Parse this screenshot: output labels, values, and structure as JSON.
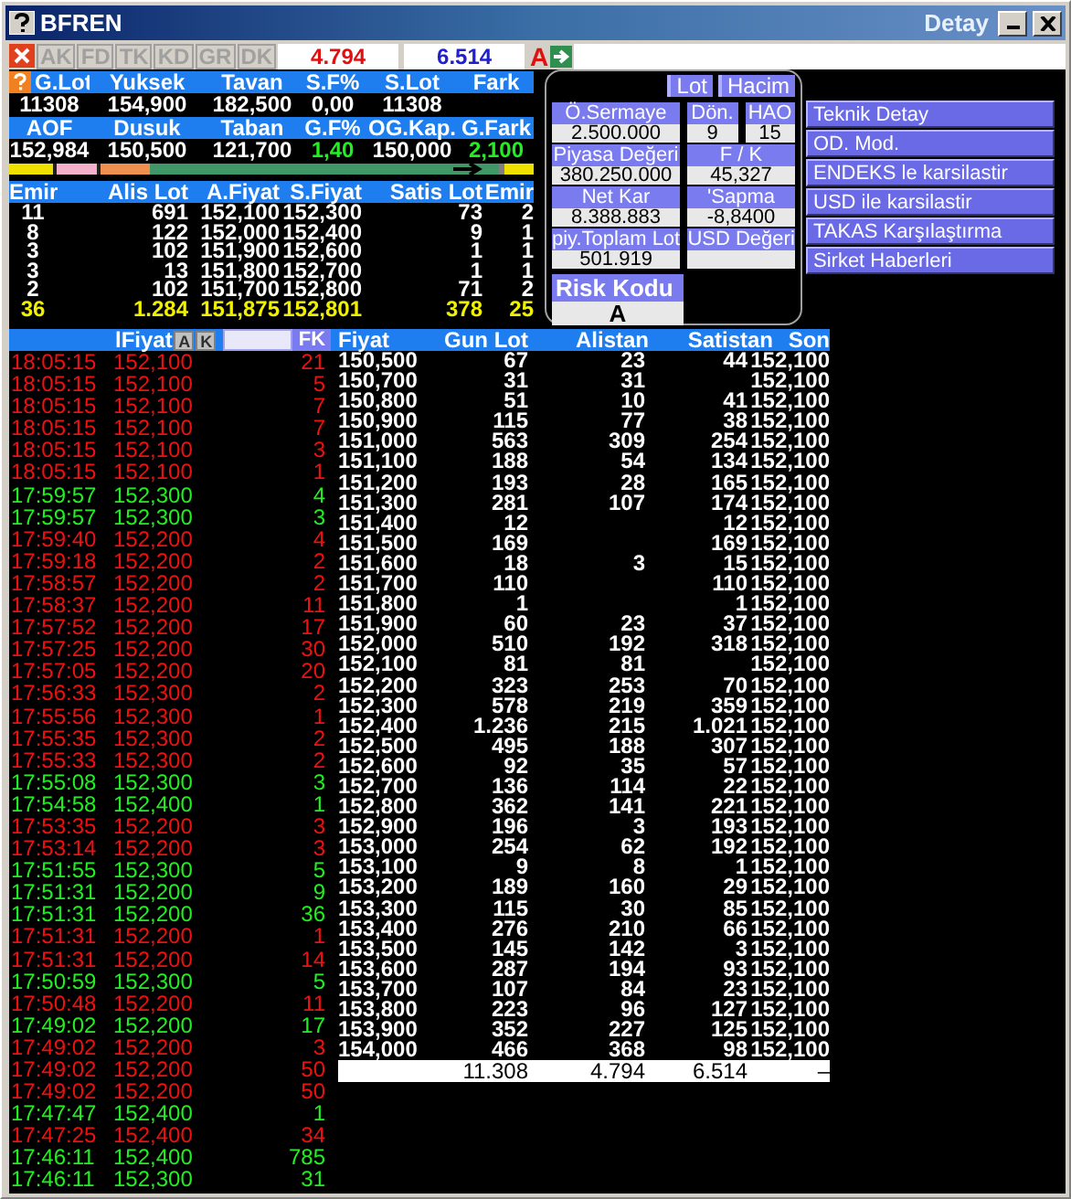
{
  "window": {
    "title": "BFREN",
    "detail_label": "Detay"
  },
  "toolbar": {
    "tabs": [
      "AK",
      "FD",
      "TK",
      "KD",
      "GR",
      "DK"
    ],
    "buy_total": "4.794",
    "sell_total": "6.514",
    "flag": "A"
  },
  "summary": [
    {
      "label": "G.Lot",
      "value": "11308",
      "uptick": false
    },
    {
      "label": "Yuksek",
      "value": "154,900",
      "uptick": false
    },
    {
      "label": "Tavan",
      "value": "182,500",
      "uptick": false
    },
    {
      "label": "S.F%",
      "value": "0,00",
      "uptick": false
    },
    {
      "label": "S.Lot",
      "value": "11308",
      "uptick": false
    },
    {
      "label": "Fark"
    },
    {
      "label": "AOF",
      "value": "152,984",
      "uptick": false
    },
    {
      "label": "Dusuk",
      "value": "150,500",
      "uptick": false
    },
    {
      "label": "Taban",
      "value": "121,700",
      "uptick": false
    },
    {
      "label": "G.F%",
      "value": "1,40",
      "uptick": true
    },
    {
      "label": "OG.Kap.",
      "value": "150,000",
      "uptick": false
    },
    {
      "label": "G.Fark",
      "value": "2,100",
      "uptick": true
    }
  ],
  "order_book": {
    "columns": [
      "Emir",
      "Alis Lot",
      "A.Fiyat",
      "S.Fiyat",
      "Satis Lot",
      "Emir"
    ],
    "rows": [
      [
        "11",
        "691",
        "152,100",
        "152,300",
        "73",
        "2"
      ],
      [
        "8",
        "122",
        "152,000",
        "152,400",
        "9",
        "1"
      ],
      [
        "3",
        "102",
        "151,900",
        "152,600",
        "1",
        "1"
      ],
      [
        "3",
        "13",
        "151,800",
        "152,700",
        "1",
        "1"
      ],
      [
        "2",
        "102",
        "151,700",
        "152,800",
        "71",
        "2"
      ]
    ],
    "total": [
      "36",
      "1.284",
      "151,875",
      "152,801",
      "378",
      "25"
    ]
  },
  "detail_panel": {
    "toggles": [
      "Lot",
      "Hacim"
    ],
    "rows": [
      [
        {
          "label": "Ö.Sermaye",
          "value": "2.500.000"
        },
        {
          "label": "Dön.",
          "value": "9"
        },
        {
          "label": "HAO",
          "value": "15"
        }
      ],
      [
        {
          "label": "Piyasa Değeri",
          "value": "380.250.000"
        },
        {
          "label": "F / K",
          "value": "45,327"
        }
      ],
      [
        {
          "label": "Net Kar",
          "value": "8.388.883"
        },
        {
          "label": "'Sapma",
          "value": "-8,8400"
        }
      ],
      [
        {
          "label": "piy.Toplam Lot",
          "value": "501.919"
        },
        {
          "label": "USD Değeri"
        }
      ]
    ],
    "risk": {
      "label": "Risk Kodu",
      "value": "A"
    }
  },
  "side_buttons": [
    "Teknik Detay",
    "OD. Mod.",
    "ENDEKS le karsilastir",
    "USD ile karsilastir",
    "TAKAS Karşılaştırma",
    "Sirket Haberleri"
  ],
  "trades": {
    "column": "lFiyat",
    "buttons": [
      "A",
      "K"
    ],
    "filter_button": "FK",
    "rows": [
      {
        "time": "18:05:15",
        "price": "152,100",
        "lot": "21",
        "uptick": false
      },
      {
        "time": "18:05:15",
        "price": "152,100",
        "lot": "5",
        "uptick": false
      },
      {
        "time": "18:05:15",
        "price": "152,100",
        "lot": "7",
        "uptick": false
      },
      {
        "time": "18:05:15",
        "price": "152,100",
        "lot": "7",
        "uptick": false
      },
      {
        "time": "18:05:15",
        "price": "152,100",
        "lot": "3",
        "uptick": false
      },
      {
        "time": "18:05:15",
        "price": "152,100",
        "lot": "1",
        "uptick": false
      },
      {
        "time": "17:59:57",
        "price": "152,300",
        "lot": "4",
        "uptick": true
      },
      {
        "time": "17:59:57",
        "price": "152,300",
        "lot": "3",
        "uptick": true
      },
      {
        "time": "17:59:40",
        "price": "152,200",
        "lot": "4",
        "uptick": false
      },
      {
        "time": "17:59:18",
        "price": "152,200",
        "lot": "2",
        "uptick": false
      },
      {
        "time": "17:58:57",
        "price": "152,200",
        "lot": "2",
        "uptick": false
      },
      {
        "time": "17:58:37",
        "price": "152,200",
        "lot": "11",
        "uptick": false
      },
      {
        "time": "17:57:52",
        "price": "152,200",
        "lot": "17",
        "uptick": false
      },
      {
        "time": "17:57:25",
        "price": "152,200",
        "lot": "30",
        "uptick": false
      },
      {
        "time": "17:57:05",
        "price": "152,200",
        "lot": "20",
        "uptick": false
      },
      {
        "time": "17:56:33",
        "price": "152,300",
        "lot": "2",
        "uptick": false
      },
      {
        "time": "17:55:56",
        "price": "152,300",
        "lot": "1",
        "uptick": false
      },
      {
        "time": "17:55:35",
        "price": "152,300",
        "lot": "2",
        "uptick": false
      },
      {
        "time": "17:55:33",
        "price": "152,300",
        "lot": "2",
        "uptick": false
      },
      {
        "time": "17:55:08",
        "price": "152,300",
        "lot": "3",
        "uptick": true
      },
      {
        "time": "17:54:58",
        "price": "152,400",
        "lot": "1",
        "uptick": true
      },
      {
        "time": "17:53:35",
        "price": "152,200",
        "lot": "3",
        "uptick": false
      },
      {
        "time": "17:53:14",
        "price": "152,200",
        "lot": "3",
        "uptick": false
      },
      {
        "time": "17:51:55",
        "price": "152,300",
        "lot": "5",
        "uptick": true
      },
      {
        "time": "17:51:31",
        "price": "152,200",
        "lot": "9",
        "uptick": true
      },
      {
        "time": "17:51:31",
        "price": "152,200",
        "lot": "36",
        "uptick": true
      },
      {
        "time": "17:51:31",
        "price": "152,200",
        "lot": "1",
        "uptick": false
      },
      {
        "time": "17:51:31",
        "price": "152,200",
        "lot": "14",
        "uptick": false
      },
      {
        "time": "17:50:59",
        "price": "152,300",
        "lot": "5",
        "uptick": true
      },
      {
        "time": "17:50:48",
        "price": "152,200",
        "lot": "11",
        "uptick": false
      },
      {
        "time": "17:49:02",
        "price": "152,200",
        "lot": "17",
        "uptick": true
      },
      {
        "time": "17:49:02",
        "price": "152,200",
        "lot": "3",
        "uptick": false
      },
      {
        "time": "17:49:02",
        "price": "152,200",
        "lot": "50",
        "uptick": false
      },
      {
        "time": "17:49:02",
        "price": "152,200",
        "lot": "50",
        "uptick": false
      },
      {
        "time": "17:47:47",
        "price": "152,400",
        "lot": "1",
        "uptick": true
      },
      {
        "time": "17:47:25",
        "price": "152,400",
        "lot": "34",
        "uptick": false
      },
      {
        "time": "17:46:11",
        "price": "152,400",
        "lot": "785",
        "uptick": true
      },
      {
        "time": "17:46:11",
        "price": "152,300",
        "lot": "31",
        "uptick": true
      }
    ]
  },
  "depth": {
    "columns": [
      "Fiyat",
      "Gun Lot",
      "Alistan",
      "Satistan",
      "Son"
    ],
    "rows": [
      {
        "price": "150,500",
        "gun_lot": "67",
        "alistan": "23",
        "satistan": "44",
        "son": "152,100"
      },
      {
        "price": "150,700",
        "gun_lot": "31",
        "alistan": "31",
        "son": "152,100"
      },
      {
        "price": "150,800",
        "gun_lot": "51",
        "alistan": "10",
        "satistan": "41",
        "son": "152,100"
      },
      {
        "price": "150,900",
        "gun_lot": "115",
        "alistan": "77",
        "satistan": "38",
        "son": "152,100"
      },
      {
        "price": "151,000",
        "gun_lot": "563",
        "alistan": "309",
        "satistan": "254",
        "son": "152,100"
      },
      {
        "price": "151,100",
        "gun_lot": "188",
        "alistan": "54",
        "satistan": "134",
        "son": "152,100"
      },
      {
        "price": "151,200",
        "gun_lot": "193",
        "alistan": "28",
        "satistan": "165",
        "son": "152,100"
      },
      {
        "price": "151,300",
        "gun_lot": "281",
        "alistan": "107",
        "satistan": "174",
        "son": "152,100"
      },
      {
        "price": "151,400",
        "gun_lot": "12",
        "satistan": "12",
        "son": "152,100"
      },
      {
        "price": "151,500",
        "gun_lot": "169",
        "satistan": "169",
        "son": "152,100"
      },
      {
        "price": "151,600",
        "gun_lot": "18",
        "alistan": "3",
        "satistan": "15",
        "son": "152,100"
      },
      {
        "price": "151,700",
        "gun_lot": "110",
        "satistan": "110",
        "son": "152,100"
      },
      {
        "price": "151,800",
        "gun_lot": "1",
        "satistan": "1",
        "son": "152,100"
      },
      {
        "price": "151,900",
        "gun_lot": "60",
        "alistan": "23",
        "satistan": "37",
        "son": "152,100"
      },
      {
        "price": "152,000",
        "gun_lot": "510",
        "alistan": "192",
        "satistan": "318",
        "son": "152,100"
      },
      {
        "price": "152,100",
        "gun_lot": "81",
        "alistan": "81",
        "son": "152,100"
      },
      {
        "price": "152,200",
        "gun_lot": "323",
        "alistan": "253",
        "satistan": "70",
        "son": "152,100"
      },
      {
        "price": "152,300",
        "gun_lot": "578",
        "alistan": "219",
        "satistan": "359",
        "son": "152,100"
      },
      {
        "price": "152,400",
        "gun_lot": "1.236",
        "alistan": "215",
        "satistan": "1.021",
        "son": "152,100"
      },
      {
        "price": "152,500",
        "gun_lot": "495",
        "alistan": "188",
        "satistan": "307",
        "son": "152,100"
      },
      {
        "price": "152,600",
        "gun_lot": "92",
        "alistan": "35",
        "satistan": "57",
        "son": "152,100"
      },
      {
        "price": "152,700",
        "gun_lot": "136",
        "alistan": "114",
        "satistan": "22",
        "son": "152,100"
      },
      {
        "price": "152,800",
        "gun_lot": "362",
        "alistan": "141",
        "satistan": "221",
        "son": "152,100"
      },
      {
        "price": "152,900",
        "gun_lot": "196",
        "alistan": "3",
        "satistan": "193",
        "son": "152,100"
      },
      {
        "price": "153,000",
        "gun_lot": "254",
        "alistan": "62",
        "satistan": "192",
        "son": "152,100"
      },
      {
        "price": "153,100",
        "gun_lot": "9",
        "alistan": "8",
        "satistan": "1",
        "son": "152,100"
      },
      {
        "price": "153,200",
        "gun_lot": "189",
        "alistan": "160",
        "satistan": "29",
        "son": "152,100"
      },
      {
        "price": "153,300",
        "gun_lot": "115",
        "alistan": "30",
        "satistan": "85",
        "son": "152,100"
      },
      {
        "price": "153,400",
        "gun_lot": "276",
        "alistan": "210",
        "satistan": "66",
        "son": "152,100"
      },
      {
        "price": "153,500",
        "gun_lot": "145",
        "alistan": "142",
        "satistan": "3",
        "son": "152,100"
      },
      {
        "price": "153,600",
        "gun_lot": "287",
        "alistan": "194",
        "satistan": "93",
        "son": "152,100"
      },
      {
        "price": "153,700",
        "gun_lot": "107",
        "alistan": "84",
        "satistan": "23",
        "son": "152,100"
      },
      {
        "price": "153,800",
        "gun_lot": "223",
        "alistan": "96",
        "satistan": "127",
        "son": "152,100"
      },
      {
        "price": "153,900",
        "gun_lot": "352",
        "alistan": "227",
        "satistan": "125",
        "son": "152,100"
      },
      {
        "price": "154,000",
        "gun_lot": "466",
        "alistan": "368",
        "satistan": "98",
        "son": "152,100"
      }
    ],
    "total": {
      "gun_lot": "11.308",
      "alistan": "4.794",
      "satistan": "6.514",
      "son": "–"
    }
  }
}
